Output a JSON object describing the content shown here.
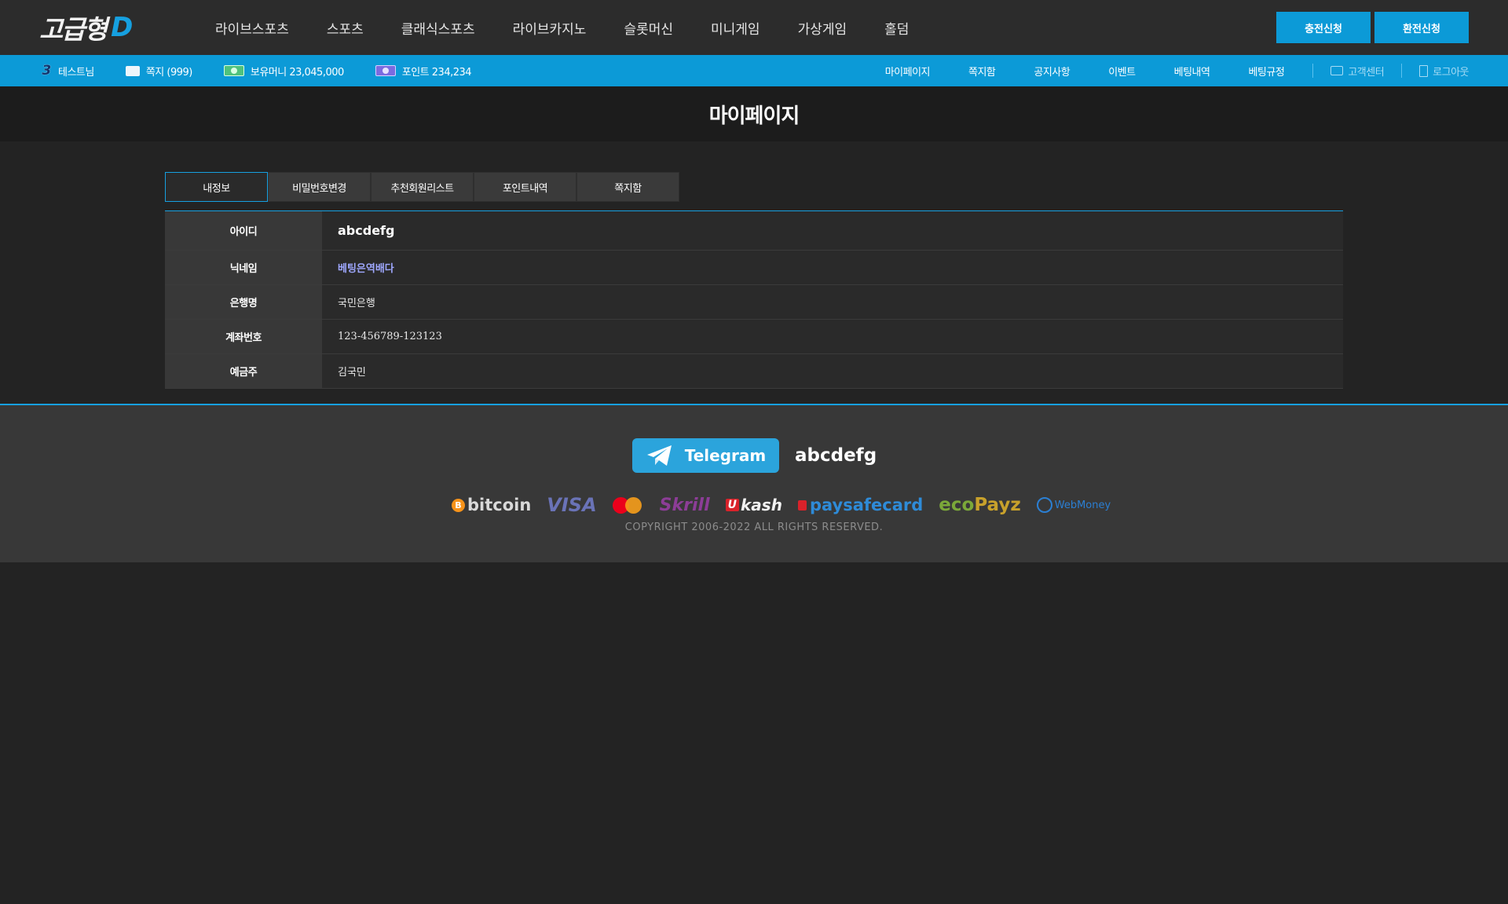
{
  "header": {
    "logo_text": "고급형",
    "logo_mark": "D",
    "nav": [
      "라이브스포츠",
      "스포츠",
      "클래식스포츠",
      "라이브카지노",
      "슬롯머신",
      "미니게임",
      "가상게임",
      "홀덤"
    ],
    "deposit_label": "충전신청",
    "withdraw_label": "환전신청"
  },
  "infobar": {
    "level": "3",
    "user": "테스트님",
    "messages": "쪽지 (999)",
    "money": "보유머니 23,045,000",
    "points": "포인트 234,234",
    "links": [
      "마이페이지",
      "쪽지함",
      "공지사항",
      "이벤트",
      "베팅내역",
      "베팅규정"
    ],
    "support_label": "고객센터",
    "logout_label": "로그아웃"
  },
  "page": {
    "title": "마이페이지"
  },
  "tabs": [
    {
      "label": "내정보",
      "active": true
    },
    {
      "label": "비밀번호변경",
      "active": false
    },
    {
      "label": "추천회원리스트",
      "active": false
    },
    {
      "label": "포인트내역",
      "active": false
    },
    {
      "label": "쪽지함",
      "active": false
    }
  ],
  "profile": {
    "rows": [
      {
        "label": "아이디",
        "value": "abcdefg"
      },
      {
        "label": "닉네임",
        "value": "베팅은역배다"
      },
      {
        "label": "은행명",
        "value": "국민은행"
      },
      {
        "label": "계좌번호",
        "value": "123-456789-123123"
      },
      {
        "label": "예금주",
        "value": "김국민"
      }
    ]
  },
  "footer": {
    "telegram_label": "Telegram",
    "telegram_id": "abcdefg",
    "payments": {
      "bitcoin": "bitcoin",
      "bitcoin_symbol": "B",
      "visa": "VISA",
      "skrill": "Skrill",
      "ukash_u": "U",
      "ukash": "kash",
      "paysafecard": "paysafecard",
      "ecopayz_eco": "eco",
      "ecopayz_payz": "Payz",
      "webmoney": "WebMoney"
    },
    "copyright": "COPYRIGHT  2006-2022  ALL RIGHTS RESERVED."
  },
  "colors": {
    "accent": "#0c9ad7",
    "header_bg": "#2c2c2c",
    "body_bg": "#232323",
    "nickname": "#9fa8ff"
  }
}
